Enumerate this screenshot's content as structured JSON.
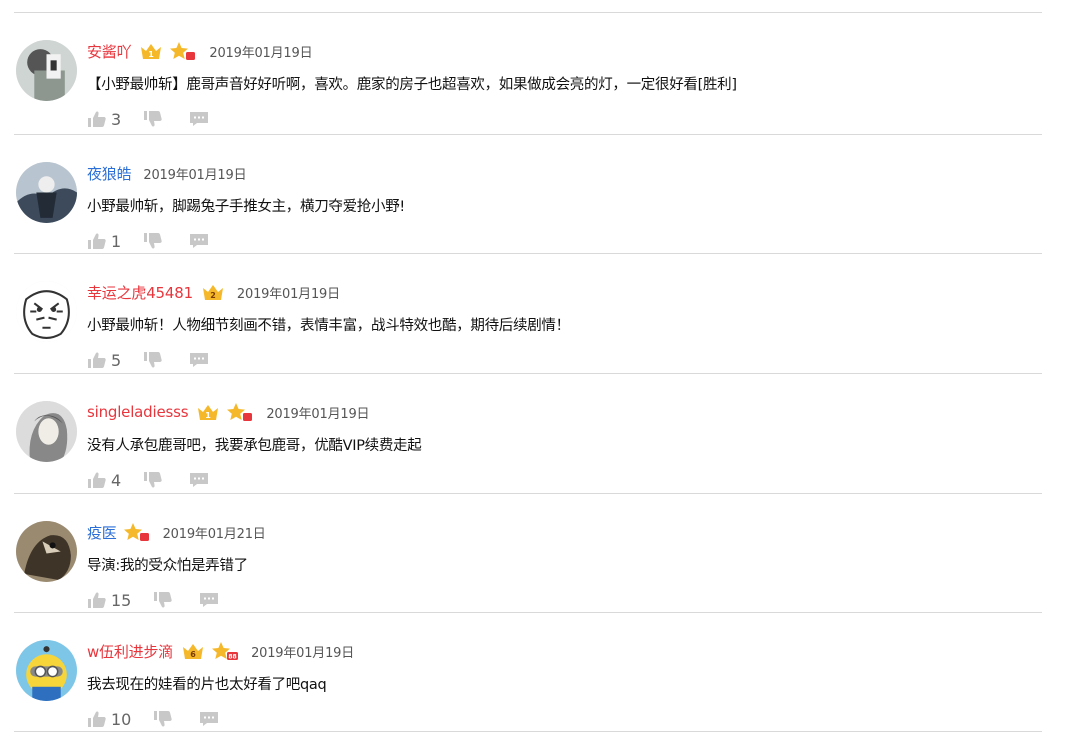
{
  "colors": {
    "vip_red": "#e8363d",
    "user_blue": "#2c6fd6",
    "badge_gold": "#f5b82b",
    "icon_gray": "#c8c8c8"
  },
  "comments": [
    {
      "name": "安酱吖",
      "name_color": "red",
      "badge": "1",
      "star": true,
      "star_tag": "",
      "date": "2019年01月19日",
      "text": "【小野最帅斩】鹿哥声音好好听啊，喜欢。鹿家的房子也超喜欢，如果做成会亮的灯，一定很好看[胜利]",
      "likes": "3"
    },
    {
      "name": "夜狼皓",
      "name_color": "blue",
      "badge": "",
      "star": false,
      "star_tag": "",
      "date": "2019年01月19日",
      "text": "小野最帅斩，脚踢兔子手推女主，横刀夺爱抢小野!",
      "likes": "1"
    },
    {
      "name": "幸运之虎45481",
      "name_color": "red",
      "badge": "2",
      "star": false,
      "star_tag": "",
      "date": "2019年01月19日",
      "text": "小野最帅斩！人物细节刻画不错，表情丰富，战斗特效也酷，期待后续剧情！",
      "likes": "5"
    },
    {
      "name": "singleladiesss",
      "name_color": "red",
      "badge": "1",
      "star": true,
      "star_tag": "",
      "date": "2019年01月19日",
      "text": "没有人承包鹿哥吧，我要承包鹿哥，优酷VIP续费走起",
      "likes": "4"
    },
    {
      "name": "疫医",
      "name_color": "blue",
      "badge": "",
      "star": true,
      "star_tag": "",
      "date": "2019年01月21日",
      "text": "导演:我的受众怕是弄错了",
      "likes": "15"
    },
    {
      "name": "w伍利进步滴",
      "name_color": "red",
      "badge": "6",
      "star": true,
      "star_tag": "88",
      "date": "2019年01月19日",
      "text": "我去现在的娃看的片也太好看了吧qaq",
      "likes": "10"
    }
  ]
}
